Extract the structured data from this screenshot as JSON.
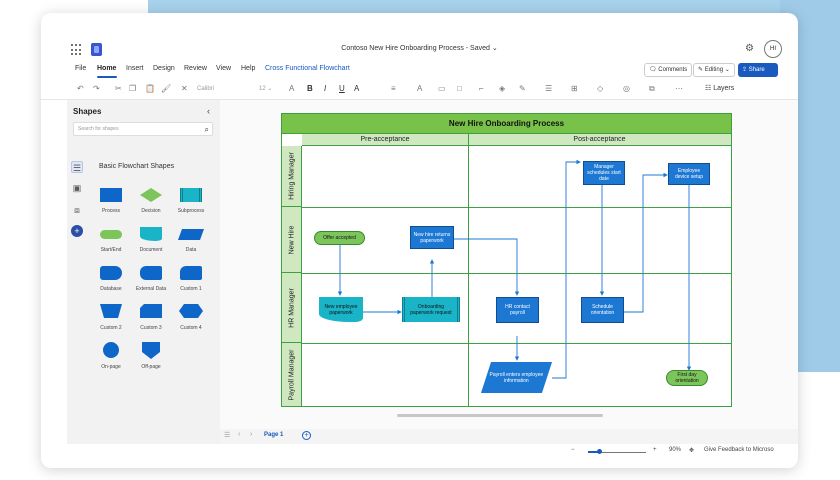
{
  "app": {
    "doc_title": "Contoso New Hire Onboarding Process - Saved",
    "avatar": "HI"
  },
  "menu": {
    "items": [
      "File",
      "Home",
      "Insert",
      "Design",
      "Review",
      "View",
      "Help"
    ],
    "active": "Home",
    "context_tab": "Cross Functional Flowchart"
  },
  "actions": {
    "comments": "Comments",
    "editing": "Editing",
    "share": "Share"
  },
  "toolbar": {
    "font": "Calibri",
    "size": "12",
    "layers": "Layers"
  },
  "shapes_panel": {
    "title": "Shapes",
    "search_placeholder": "Search for shapes",
    "category": "Basic Flowchart Shapes",
    "shapes": [
      "Process",
      "Decision",
      "Subprocess",
      "Start/End",
      "Document",
      "Data",
      "Database",
      "External Data",
      "Custom 1",
      "Custom 2",
      "Custom 3",
      "Custom 4",
      "On-page",
      "Off-page"
    ]
  },
  "diagram": {
    "title": "New Hire Onboarding Process",
    "phases": [
      "Pre-acceptance",
      "Post-acceptance"
    ],
    "lanes": [
      "Hiring Manager",
      "New Hire",
      "HR Manager",
      "Payroll Manager"
    ],
    "nodes": {
      "manager_schedules": "Manager schedules start date",
      "employee_device": "Employee device setup",
      "offer_accepted": "Offer accepted",
      "returns_paperwork": "New hire returns paperwork",
      "new_employee_paperwork": "New employee paperwork",
      "onboarding_request": "Onboarding paperwork request",
      "hr_contact_payroll": "HR contact payroll",
      "schedule_orientation": "Schedule orientation",
      "payroll_enters": "Payroll enters employee information",
      "first_day": "First day orientation"
    },
    "colors": {
      "header": "#79c24a",
      "lane_fill": "#cfe8c0",
      "border": "#3da142",
      "process": "#1c78d3",
      "document": "#1ab4c8",
      "terminator": "#7cc55b"
    }
  },
  "pages": {
    "current": "Page 1"
  },
  "status": {
    "zoom": "90%",
    "feedback": "Give Feedback to Microso"
  }
}
